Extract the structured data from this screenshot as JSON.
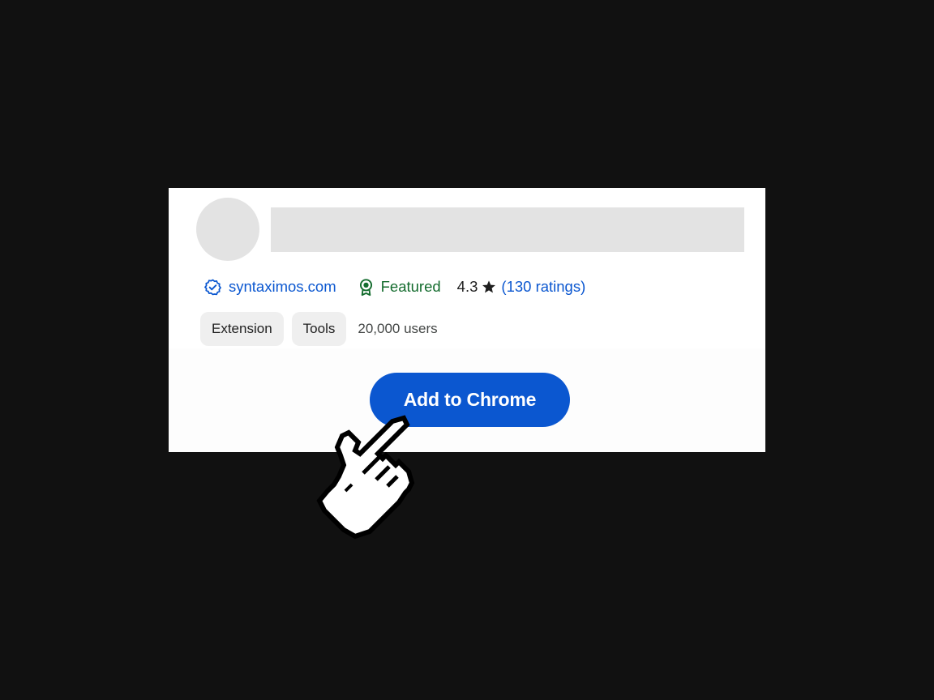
{
  "listing": {
    "publisher": "syntaximos.com",
    "featured_label": "Featured",
    "rating_value": "4.3",
    "rating_open_paren": "(",
    "rating_count_link": "130 ratings",
    "rating_close_paren": ")",
    "chips": [
      "Extension",
      "Tools"
    ],
    "users": "20,000 users",
    "add_button_label": "Add to Chrome"
  },
  "icons": {
    "publisher": "verified-badge-icon",
    "featured": "featured-award-icon",
    "star": "star-icon",
    "pointer": "hand-pointer-cursor-icon"
  },
  "colors": {
    "background": "#111111",
    "accent_blue": "#0b57d0",
    "featured_green": "#146c2e",
    "skeleton_gray": "#e3e3e3",
    "chip_gray": "#efefef"
  }
}
